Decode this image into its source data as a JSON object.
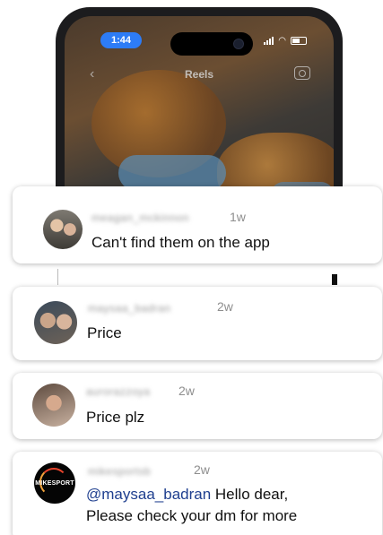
{
  "status_bar": {
    "time": "1:44"
  },
  "reels_header": {
    "title": "Reels"
  },
  "comments": [
    {
      "username": "meagan_mckinnon",
      "time": "1w",
      "text": "Can't find them on the app"
    },
    {
      "username": "maysaa_badran",
      "time": "2w",
      "text": "Price"
    },
    {
      "username": "aurorazzoya",
      "time": "2w",
      "text": "Price plz"
    },
    {
      "username": "mikesportsb",
      "time": "2w",
      "mention": "@maysaa_badran",
      "text_line1": "Hello dear,",
      "text_line2": "Please check your dm for more"
    }
  ],
  "brand_avatar_text": "MIKESPORT",
  "icons": [
    "back-chevron-icon",
    "camera-icon",
    "signal-icon",
    "wifi-icon",
    "battery-icon"
  ]
}
